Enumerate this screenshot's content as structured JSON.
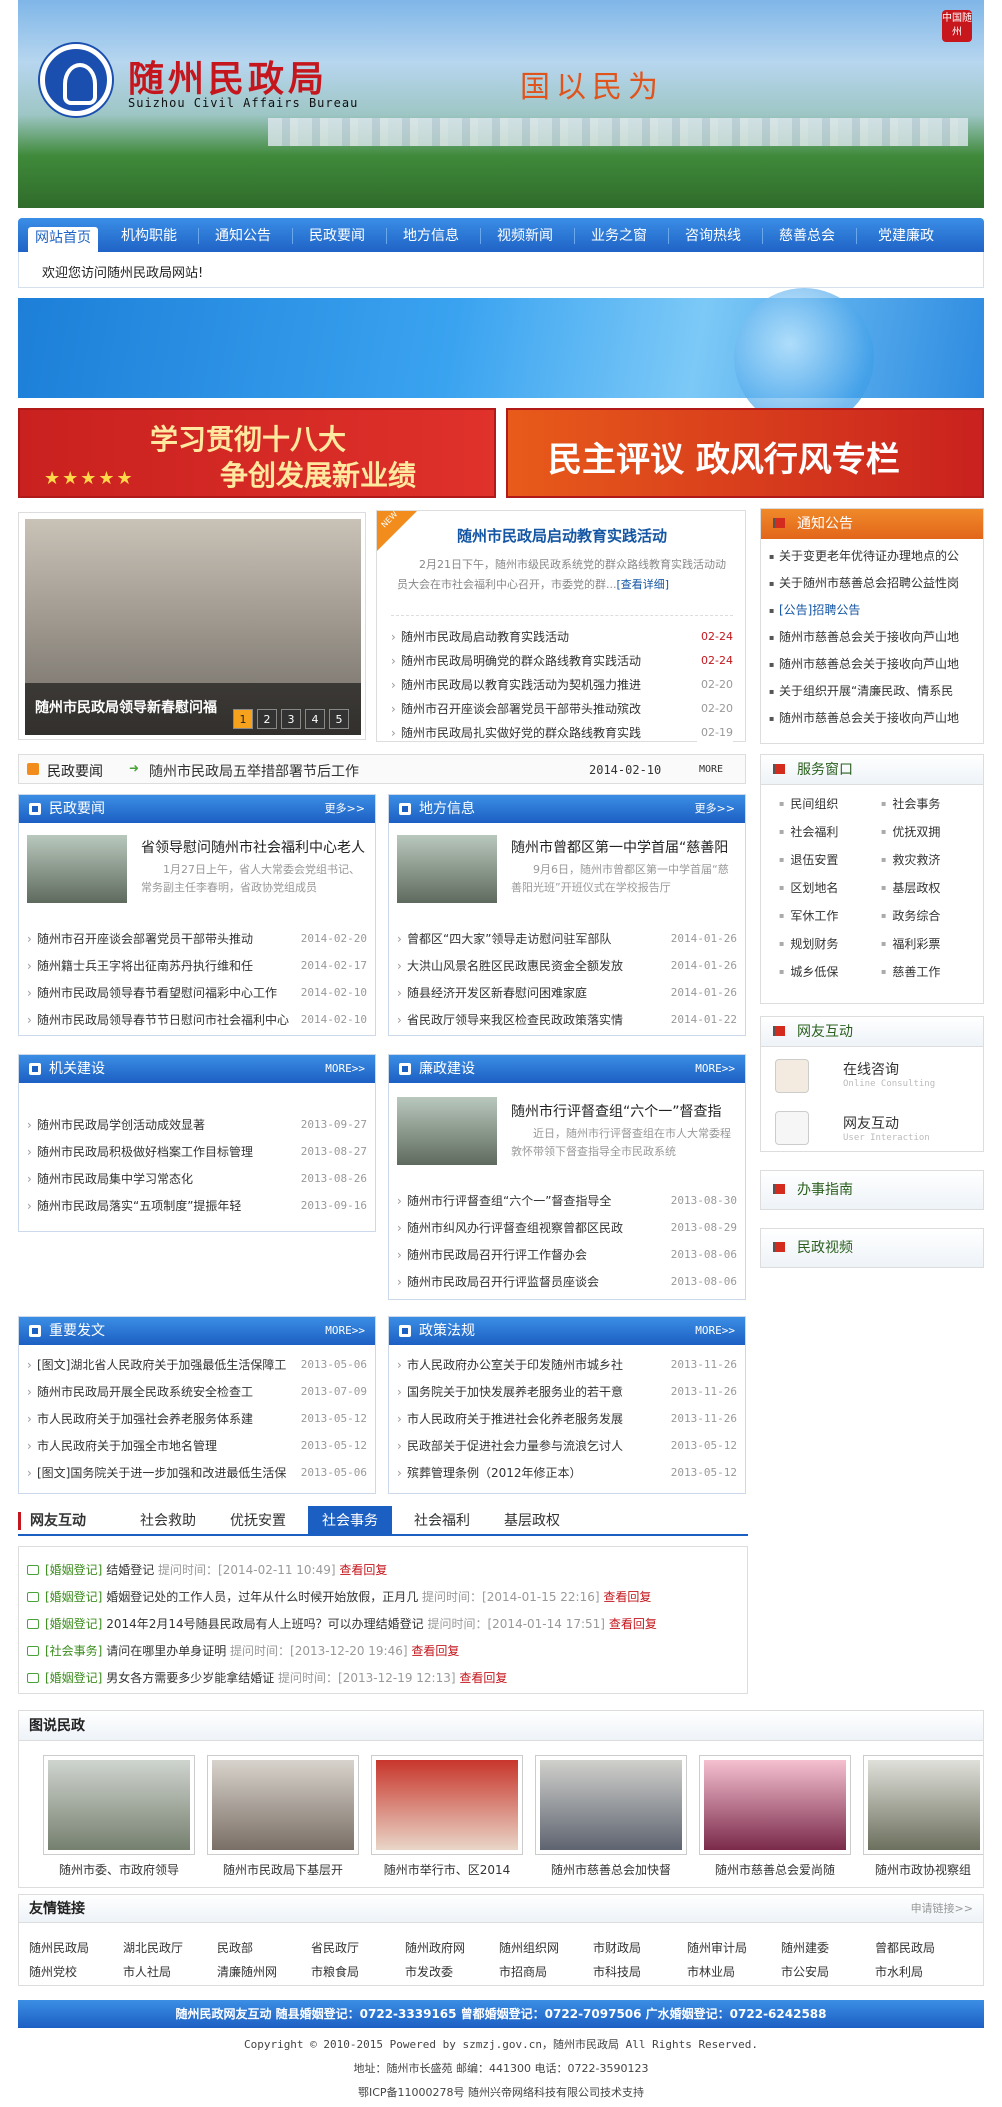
{
  "header": {
    "logo_cn": "随州民政局",
    "logo_en": "Suizhou Civil Affairs Bureau",
    "slogan": "国以民为",
    "seal": "中国随州"
  },
  "nav": {
    "items": [
      "网站首页",
      "机构职能",
      "通知公告",
      "民政要闻",
      "地方信息",
      "视频新闻",
      "业务之窗",
      "咨询热线",
      "慈善总会",
      "党建廉政"
    ],
    "active_index": 0
  },
  "welcome": "欢迎您访问随州民政局网站!",
  "promos": {
    "left": {
      "line1": "学习贯彻十八大",
      "line2": "争创发展新业绩"
    },
    "right": {
      "text": "民主评议 政风行风专栏"
    }
  },
  "slideshow": {
    "caption": "随州市民政局领导新春慰问福",
    "pages": [
      "1",
      "2",
      "3",
      "4",
      "5"
    ],
    "active_page": 0
  },
  "headline": {
    "new_tag": "NEW",
    "title": "随州市民政局启动教育实践活动",
    "summary": "2月21日下午，随州市级民政系统党的群众路线教育实践活动动员大会在市社会福利中心召开，市委党的群...",
    "more": "[查看详细]",
    "items": [
      {
        "title": "随州市民政局启动教育实践活动",
        "date": "02-24",
        "hot": true
      },
      {
        "title": "随州市民政局明确党的群众路线教育实践活动",
        "date": "02-24",
        "hot": true
      },
      {
        "title": "随州市民政局以教育实践活动为契机强力推进",
        "date": "02-20",
        "hot": false
      },
      {
        "title": "随州市召开座谈会部署党员干部带头推动殡改",
        "date": "02-20",
        "hot": false
      },
      {
        "title": "随州市民政局扎实做好党的群众路线教育实践",
        "date": "02-19",
        "hot": false
      }
    ]
  },
  "notice": {
    "title": "通知公告",
    "items": [
      "关于变更老年优待证办理地点的公",
      "关于随州市慈善总会招聘公益性岗",
      "[公告]招聘公告",
      "随州市慈善总会关于接收向芦山地",
      "随州市慈善总会关于接收向芦山地",
      "关于组织开展“清廉民政、情系民",
      "随州市慈善总会关于接收向芦山地"
    ]
  },
  "ticker": {
    "label": "民政要闻",
    "text": "随州市民政局五举措部署节后工作",
    "date": "2014-02-10",
    "more": "MORE"
  },
  "panels": {
    "mzyw": {
      "title": "民政要闻",
      "more": "更多>>",
      "feat_title": "省领导慰问随州市社会福利中心老人",
      "feat_sum": "1月27日上午，省人大常委会党组书记、常务副主任李春明，省政协党组成员",
      "items": [
        {
          "title": "随州市召开座谈会部署党员干部带头推动",
          "date": "2014-02-20"
        },
        {
          "title": "随州籍士兵王字将出征南苏丹执行维和任",
          "date": "2014-02-17"
        },
        {
          "title": "随州市民政局领导春节看望慰问福彩中心工作",
          "date": "2014-02-10"
        },
        {
          "title": "随州市民政局领导春节节日慰问市社会福利中心",
          "date": "2014-02-10"
        }
      ]
    },
    "dfxx": {
      "title": "地方信息",
      "more": "更多>>",
      "feat_title": "随州市曾都区第一中学首届“慈善阳",
      "feat_sum": "9月6日，随州市曾都区第一中学首届“慈善阳光班”开班仪式在学校报告厅",
      "items": [
        {
          "title": "曾都区“四大家”领导走访慰问驻军部队",
          "date": "2014-01-26"
        },
        {
          "title": "大洪山风景名胜区民政惠民资金全额发放",
          "date": "2014-01-26"
        },
        {
          "title": "随县经济开发区新春慰问困难家庭",
          "date": "2014-01-26"
        },
        {
          "title": "省民政厅领导来我区检查民政政策落实情",
          "date": "2014-01-22"
        }
      ]
    },
    "jgjs": {
      "title": "机关建设",
      "more": "MORE>>",
      "items": [
        {
          "title": "随州市民政局学创活动成效显著",
          "date": "2013-09-27"
        },
        {
          "title": "随州市民政局积极做好档案工作目标管理",
          "date": "2013-08-27"
        },
        {
          "title": "随州市民政局集中学习常态化",
          "date": "2013-08-26"
        },
        {
          "title": "随州市民政局落实“五项制度”提振年轻",
          "date": "2013-09-16"
        }
      ]
    },
    "lzjs": {
      "title": "廉政建设",
      "more": "MORE>>",
      "feat_title": "随州市行评督查组“六个一”督查指",
      "feat_sum": "近日，随州市行评督查组在市人大常委程敦怀带领下督查指导全市民政系统",
      "items": [
        {
          "title": "随州市行评督查组“六个一”督查指导全",
          "date": "2013-08-30"
        },
        {
          "title": "随州市纠风办行评督查组视察曾都区民政",
          "date": "2013-08-29"
        },
        {
          "title": "随州市民政局召开行评工作督办会",
          "date": "2013-08-06"
        },
        {
          "title": "随州市民政局召开行评监督员座谈会",
          "date": "2013-08-06"
        }
      ]
    },
    "zyfw": {
      "title": "重要发文",
      "more": "MORE>>",
      "items": [
        {
          "title": "[图文]湖北省人民政府关于加强最低生活保障工",
          "date": "2013-05-06"
        },
        {
          "title": "随州市民政局开展全民政系统安全检查工",
          "date": "2013-07-09"
        },
        {
          "title": "市人民政府关于加强社会养老服务体系建",
          "date": "2013-05-12"
        },
        {
          "title": "市人民政府关于加强全市地名管理",
          "date": "2013-05-12"
        },
        {
          "title": "[图文]国务院关于进一步加强和改进最低生活保",
          "date": "2013-05-06"
        }
      ]
    },
    "zcfg": {
      "title": "政策法规",
      "more": "MORE>>",
      "items": [
        {
          "title": "市人民政府办公室关于印发随州市城乡社",
          "date": "2013-11-26"
        },
        {
          "title": "国务院关于加快发展养老服务业的若干意",
          "date": "2013-11-26"
        },
        {
          "title": "市人民政府关于推进社会化养老服务发展",
          "date": "2013-11-26"
        },
        {
          "title": "民政部关于促进社会力量参与流浪乞讨人",
          "date": "2013-05-12"
        },
        {
          "title": "殡葬管理条例（2012年修正本）",
          "date": "2013-05-12"
        }
      ]
    }
  },
  "service": {
    "title": "服务窗口",
    "items": [
      "民间组织",
      "社会事务",
      "社会福利",
      "优抚双拥",
      "退伍安置",
      "救灾救济",
      "区划地名",
      "基层政权",
      "军休工作",
      "政务综合",
      "规划财务",
      "福利彩票",
      "城乡低保",
      "慈善工作"
    ]
  },
  "interaction_side": {
    "title": "网友互动",
    "online": {
      "label": "在线咨询",
      "en": "Online Consulting"
    },
    "user": {
      "label": "网友互动",
      "en": "User Interaction"
    }
  },
  "guide_title": "办事指南",
  "video_title": "民政视频",
  "interaction_tabs": {
    "title": "网友互动",
    "tabs": [
      "社会救助",
      "优抚安置",
      "社会事务",
      "社会福利",
      "基层政权"
    ],
    "active_index": 2,
    "messages": [
      {
        "cat": "[婚姻登记]",
        "text": "结婚登记",
        "time": "提问时间：[2014-02-11 10:49]",
        "view": "查看回复"
      },
      {
        "cat": "[婚姻登记]",
        "text": "婚姻登记处的工作人员，过年从什么时候开始放假，正月几",
        "time": "提问时间：[2014-01-15 22:16]",
        "view": "查看回复"
      },
      {
        "cat": "[婚姻登记]",
        "text": "2014年2月14号随县民政局有人上班吗？可以办理结婚登记",
        "time": "提问时间：[2014-01-14 17:51]",
        "view": "查看回复"
      },
      {
        "cat": "[社会事务]",
        "text": "请问在哪里办单身证明",
        "time": "提问时间：[2013-12-20 19:46]",
        "view": "查看回复"
      },
      {
        "cat": "[婚姻登记]",
        "text": "男女各方需要多少岁能拿结婚证",
        "time": "提问时间：[2013-12-19 12:13]",
        "view": "查看回复"
      }
    ]
  },
  "gallery": {
    "title": "图说民政",
    "items": [
      "随州市委、市政府领导",
      "随州市民政局下基层开",
      "随州市举行市、区2014",
      "随州市慈善总会加快督",
      "随州市慈善总会爱尚随",
      "随州市政协视察组"
    ]
  },
  "links": {
    "title": "友情链接",
    "apply": "申请链接>>",
    "items": [
      "随州民政局",
      "湖北民政厅",
      "民政部",
      "省民政厅",
      "随州政府网",
      "随州组织网",
      "市财政局",
      "随州审计局",
      "随州建委",
      "曾都民政局",
      "随州党校",
      "市人社局",
      "清廉随州网",
      "市粮食局",
      "市发改委",
      "市招商局",
      "市科技局",
      "市林业局",
      "市公安局",
      "市水利局"
    ]
  },
  "footer": {
    "bar": "随州民政网友互动   随县婚姻登记：0722-3339165   曾都婚姻登记：0722-7097506   广水婚姻登记：0722-6242588",
    "copyright": "Copyright © 2010-2015 Powered by szmzj.gov.cn，随州市民政局 All Rights Reserved.",
    "address": "地址：随州市长盛苑   邮编：441300   电话：0722-3590123",
    "icp": "鄂ICP备11000278号   随州兴帝网络科技有限公司技术支持"
  },
  "colors": {
    "nav_blue": "#1f63c6",
    "accent_red": "#c4161c",
    "notice_orange": "#e2651a"
  }
}
